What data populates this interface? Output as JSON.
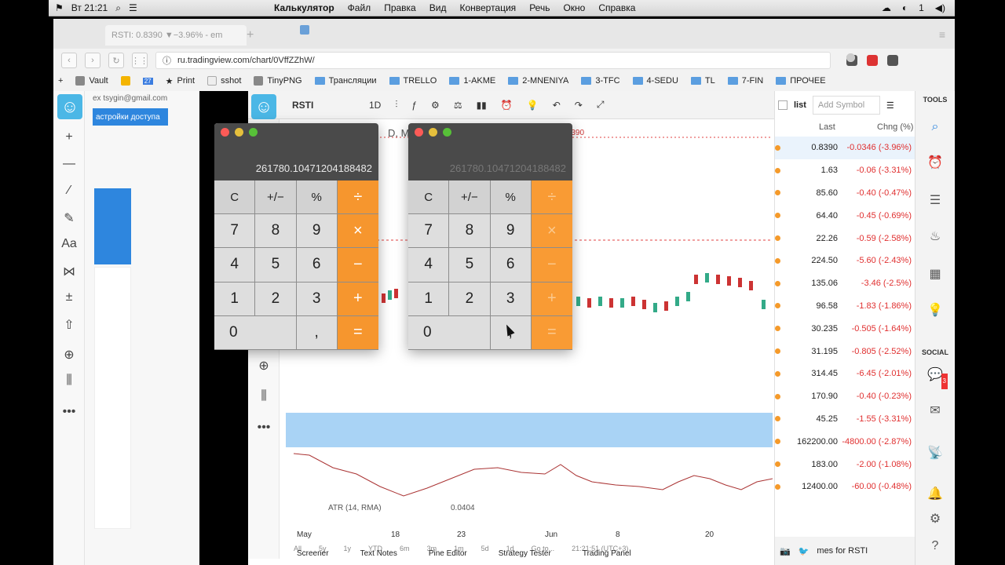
{
  "menubar": {
    "time": "Вт 21:21",
    "app_name": "Калькулятор",
    "menus": [
      "Файл",
      "Правка",
      "Вид",
      "Конвертация",
      "Речь",
      "Окно",
      "Справка"
    ],
    "battery": "1"
  },
  "browser": {
    "tab_title": "RSTI: 0.8390 ▼−3.96% - em",
    "url": "ru.tradingview.com/chart/0VffZZhW/",
    "bookmarks": [
      "Vault",
      "Print",
      "sshot",
      "TinyPNG",
      "Трансляции",
      "TRELLO",
      "1-AKME",
      "2-MNENIYA",
      "3-TFC",
      "4-SEDU",
      "TL",
      "7-FIN",
      "ПРОЧЕЕ"
    ],
    "calendar_day": "27"
  },
  "left_panel": {
    "email": "ex tsygin@gmail.com",
    "button": "астройки доступа",
    "tools": [
      "—",
      "⁄",
      "✎",
      "Aa",
      "⋈",
      "±",
      "⇧",
      "⊕",
      "⫼",
      "•••"
    ]
  },
  "tradingview": {
    "symbol": "RSTI",
    "interval": "1D",
    "legend_fragment": "D, M",
    "price_fragment": "370 C 0.8390",
    "atr_label": "ATR (14, RMA)",
    "atr_value": "0.0404",
    "x_labels": [
      "May",
      "18",
      "23",
      "Jun",
      "8",
      "20"
    ],
    "ranges": [
      "All",
      "5y",
      "1y",
      "YTD",
      "6m",
      "3m",
      "1m",
      "5d",
      "1d",
      "Go to..."
    ],
    "time_label": "21:21:51 (UTC+3)",
    "bottom_tabs": [
      "Screener",
      "Text Notes",
      "Pine Editor",
      "Strategy Tester",
      "Trading Panel"
    ]
  },
  "watchlist": {
    "title": "list",
    "add_placeholder": "Add Symbol",
    "col_last": "Last",
    "col_chng": "Chng (%)",
    "rows": [
      {
        "last": "0.8390",
        "chg": "-0.0346 (-3.96%)"
      },
      {
        "last": "1.63",
        "chg": "-0.06 (-3.31%)"
      },
      {
        "last": "85.60",
        "chg": "-0.40 (-0.47%)"
      },
      {
        "last": "64.40",
        "chg": "-0.45 (-0.69%)"
      },
      {
        "last": "22.26",
        "chg": "-0.59 (-2.58%)"
      },
      {
        "last": "224.50",
        "chg": "-5.60 (-2.43%)"
      },
      {
        "last": "135.06",
        "chg": "-3.46 (-2.5%)"
      },
      {
        "last": "96.58",
        "chg": "-1.83 (-1.86%)"
      },
      {
        "last": "30.235",
        "chg": "-0.505 (-1.64%)"
      },
      {
        "last": "31.195",
        "chg": "-0.805 (-2.52%)"
      },
      {
        "last": "314.45",
        "chg": "-6.45 (-2.01%)"
      },
      {
        "last": "170.90",
        "chg": "-0.40 (-0.23%)"
      },
      {
        "last": "45.25",
        "chg": "-1.55 (-3.31%)"
      },
      {
        "last": "162200.00",
        "chg": "-4800.00 (-2.87%)"
      },
      {
        "last": "183.00",
        "chg": "-2.00 (-1.08%)"
      },
      {
        "last": "12400.00",
        "chg": "-60.00 (-0.48%)"
      }
    ],
    "footer": "mes for RSTI"
  },
  "sidebar": {
    "tools_label": "TOOLS",
    "social_label": "SOCIAL",
    "badge": "3"
  },
  "calculator1": {
    "display": "261780.10471204188482",
    "keys": [
      "C",
      "+/−",
      "%",
      "÷",
      "7",
      "8",
      "9",
      "×",
      "4",
      "5",
      "6",
      "−",
      "1",
      "2",
      "3",
      "+",
      "0",
      ",",
      "="
    ]
  },
  "calculator2": {
    "display": "261780.10471204188482",
    "keys": [
      "C",
      "+/−",
      "%",
      "÷",
      "7",
      "8",
      "9",
      "×",
      "4",
      "5",
      "6",
      "−",
      "1",
      "2",
      "3",
      "+",
      "0",
      ",",
      "="
    ]
  },
  "colors": {
    "accent": "#2e86de",
    "calc_operator": "#f6962e",
    "negative": "#e03030",
    "watch_dot": "#f59a2a"
  }
}
